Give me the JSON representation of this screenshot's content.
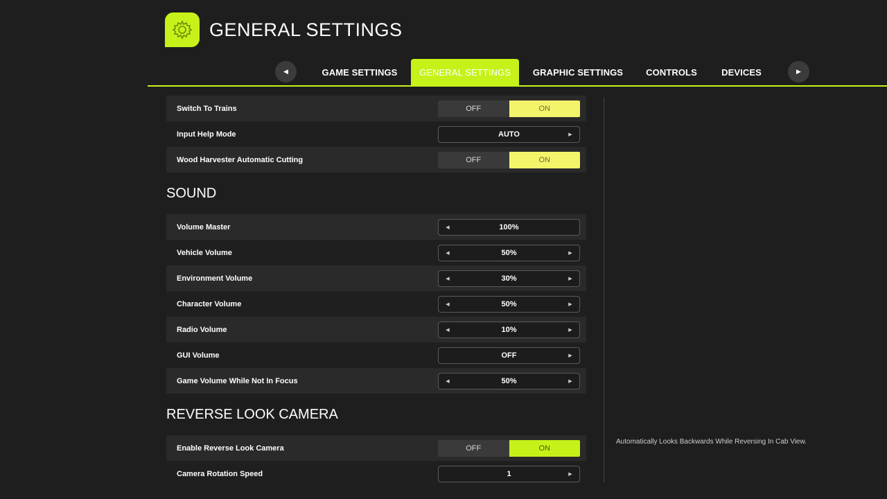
{
  "header": {
    "title": "GENERAL SETTINGS",
    "icon": "gear-icon"
  },
  "tabs": {
    "prev_icon": "◀",
    "next_icon": "▶",
    "items": [
      {
        "label": "GAME SETTINGS"
      },
      {
        "label": "GENERAL SETTINGS",
        "active": true
      },
      {
        "label": "GRAPHIC SETTINGS"
      },
      {
        "label": "CONTROLS"
      },
      {
        "label": "DEVICES"
      }
    ]
  },
  "general": {
    "switch_trains": {
      "label": "Switch To Trains",
      "off": "OFF",
      "on": "ON",
      "value": "ON"
    },
    "input_help": {
      "label": "Input Help Mode",
      "value": "AUTO"
    },
    "wood_harvester": {
      "label": "Wood Harvester Automatic Cutting",
      "off": "OFF",
      "on": "ON",
      "value": "ON"
    }
  },
  "sound": {
    "title": "SOUND",
    "master": {
      "label": "Volume Master",
      "value": "100%"
    },
    "vehicle": {
      "label": "Vehicle Volume",
      "value": "50%"
    },
    "environment": {
      "label": "Environment Volume",
      "value": "30%"
    },
    "character": {
      "label": "Character Volume",
      "value": "50%"
    },
    "radio": {
      "label": "Radio Volume",
      "value": "10%"
    },
    "gui": {
      "label": "GUI Volume",
      "value": "OFF"
    },
    "unfocused": {
      "label": "Game Volume While Not In Focus",
      "value": "50%"
    }
  },
  "reverse_camera": {
    "title": "REVERSE LOOK CAMERA",
    "enable": {
      "label": "Enable Reverse Look Camera",
      "off": "OFF",
      "on": "ON",
      "value": "ON"
    },
    "rotation_speed": {
      "label": "Camera Rotation Speed",
      "value": "1"
    }
  },
  "help": {
    "text": "Automatically Looks Backwards While Reversing In Cab View."
  },
  "colors": {
    "accent": "#c6f21a",
    "toggle_on": "#f4f46a",
    "background": "#1e1e1e"
  },
  "arrows": {
    "left": "◀",
    "right": "▶"
  }
}
